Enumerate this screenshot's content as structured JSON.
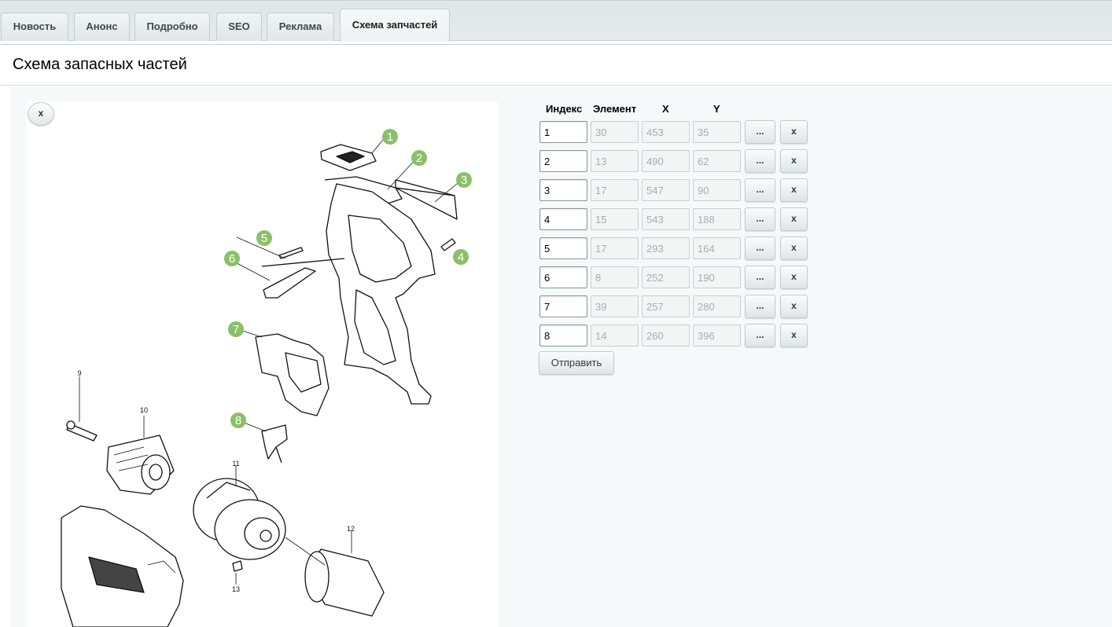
{
  "tabs": [
    {
      "label": "Новость"
    },
    {
      "label": "Анонс"
    },
    {
      "label": "Подробно"
    },
    {
      "label": "SEO"
    },
    {
      "label": "Реклама"
    },
    {
      "label": "Схема запчастей",
      "active": true
    }
  ],
  "section_title": "Схема запасных частей",
  "diagram": {
    "close_label": "x",
    "callouts": [
      "1",
      "2",
      "3",
      "4",
      "5",
      "6",
      "7",
      "8"
    ],
    "part_labels": [
      "9",
      "10",
      "11",
      "12",
      "13"
    ],
    "badge_color": "#8cbf6a"
  },
  "table": {
    "headers": {
      "index": "Индекс",
      "element": "Элемент",
      "x": "X",
      "y": "Y"
    },
    "rows": [
      {
        "index": "1",
        "element": "30",
        "x": "453",
        "y": "35"
      },
      {
        "index": "2",
        "element": "13",
        "x": "490",
        "y": "62"
      },
      {
        "index": "3",
        "element": "17",
        "x": "547",
        "y": "90"
      },
      {
        "index": "4",
        "element": "15",
        "x": "543",
        "y": "188"
      },
      {
        "index": "5",
        "element": "17",
        "x": "293",
        "y": "164"
      },
      {
        "index": "6",
        "element": "8",
        "x": "252",
        "y": "190"
      },
      {
        "index": "7",
        "element": "39",
        "x": "257",
        "y": "280"
      },
      {
        "index": "8",
        "element": "14",
        "x": "260",
        "y": "396"
      }
    ],
    "pick_label": "...",
    "delete_label": "x"
  },
  "submit_label": "Отправить"
}
